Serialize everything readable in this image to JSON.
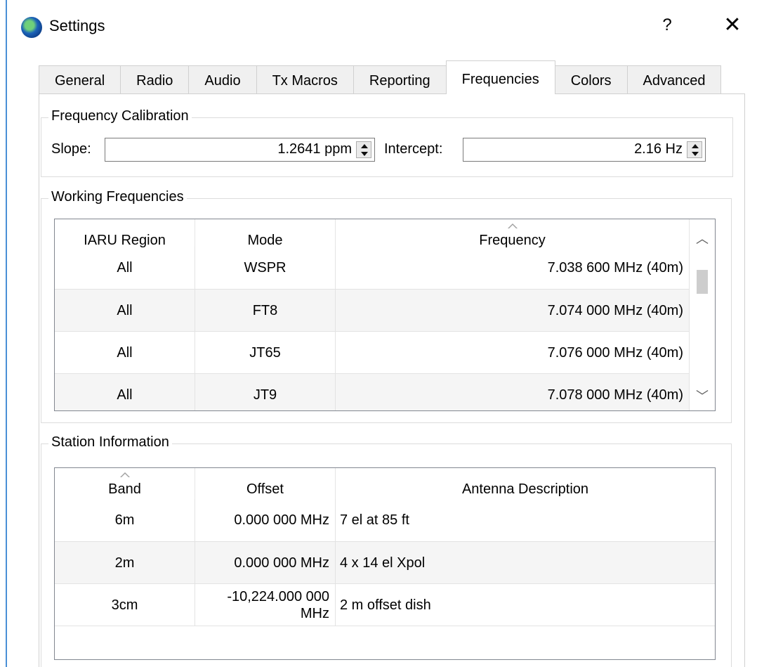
{
  "window": {
    "title": "Settings",
    "help": "?",
    "close": "✕"
  },
  "tabs": [
    "General",
    "Radio",
    "Audio",
    "Tx Macros",
    "Reporting",
    "Frequencies",
    "Colors",
    "Advanced"
  ],
  "active_tab": "Frequencies",
  "calibration": {
    "title": "Frequency Calibration",
    "slope_label": "Slope:",
    "slope_value": "1.2641 ppm",
    "intercept_label": "Intercept:",
    "intercept_value": "2.16 Hz"
  },
  "working": {
    "title": "Working Frequencies",
    "headers": [
      "IARU Region",
      "Mode",
      "Frequency"
    ],
    "rows": [
      [
        "All",
        "WSPR",
        "7.038 600 MHz (40m)"
      ],
      [
        "All",
        "FT8",
        "7.074 000 MHz (40m)"
      ],
      [
        "All",
        "JT65",
        "7.076 000 MHz (40m)"
      ],
      [
        "All",
        "JT9",
        "7.078 000 MHz (40m)"
      ]
    ]
  },
  "station": {
    "title": "Station Information",
    "headers": [
      "Band",
      "Offset",
      "Antenna Description"
    ],
    "rows": [
      {
        "band": "6m",
        "offset": "0.000 000 MHz",
        "antenna": "7 el at 85 ft"
      },
      {
        "band": "2m",
        "offset": "0.000 000 MHz",
        "antenna": "4 x 14 el Xpol"
      },
      {
        "band": "3cm",
        "offset_line1": "-10,224.000 000",
        "offset_line2": "MHz",
        "antenna": "2 m offset dish"
      }
    ]
  },
  "colors": {
    "accent": "#4a8fd6",
    "grid_border": "#828790",
    "alt_row": "#f5f5f5"
  },
  "icons": {
    "app": "globe-icon",
    "scroll_up": "chevron-up-icon",
    "scroll_down": "chevron-down-icon",
    "sort": "sort-ascending-icon"
  }
}
